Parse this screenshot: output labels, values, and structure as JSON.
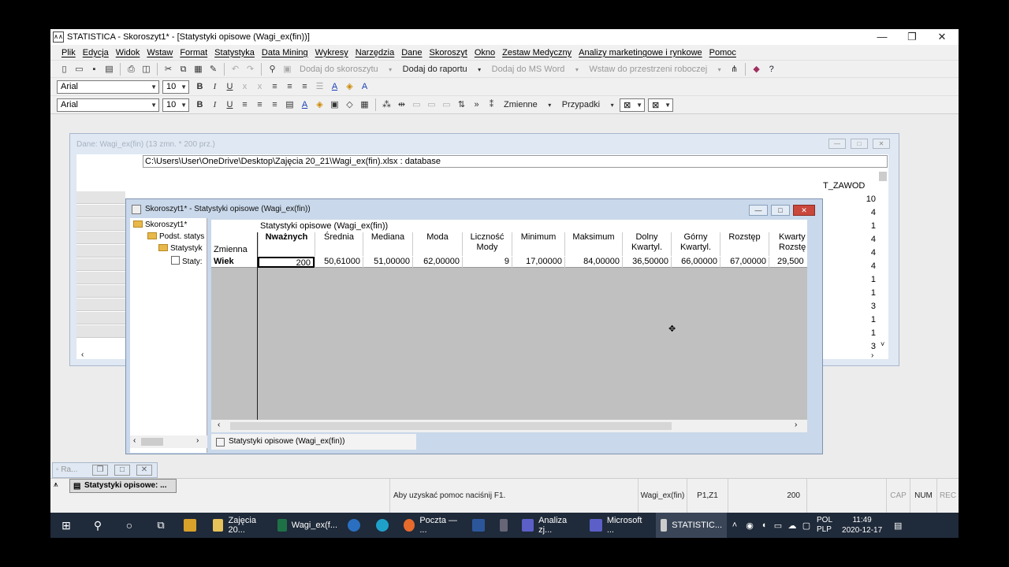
{
  "window": {
    "title": "STATISTICA - Skoroszyt1* - [Statystyki opisowe (Wagi_ex(fin))]",
    "controls": [
      "—",
      "❐",
      "✕"
    ]
  },
  "menu": [
    "Plik",
    "Edycja",
    "Widok",
    "Wstaw",
    "Format",
    "Statystyka",
    "Data Mining",
    "Wykresy",
    "Narzędzia",
    "Dane",
    "Skoroszyt",
    "Okno",
    "Zestaw Medyczny",
    "Analizy marketingowe i rynkowe",
    "Pomoc"
  ],
  "toolbar1": {
    "add_to_workbook": "Dodaj do skoroszytu",
    "add_to_report": "Dodaj do raportu",
    "add_to_msword": "Dodaj do MS Word",
    "add_to_workspace": "Wstaw do przestrzeni roboczej"
  },
  "toolbar2": {
    "font": "Arial",
    "size": "10"
  },
  "toolbar3": {
    "font": "Arial",
    "size": "10",
    "variables": "Zmienne",
    "cases": "Przypadki"
  },
  "data_window": {
    "title": "Dane: Wagi_ex(fin) (13 zmn. * 200 prz.)",
    "path": "C:\\Users\\User\\OneDrive\\Desktop\\Zajęcia 20_21\\Wagi_ex(fin).xlsx : database",
    "col_header": "T_ZAWOD",
    "values": [
      "10",
      "4",
      "1",
      "4",
      "4",
      "4",
      "1",
      "1",
      "3",
      "1",
      "1",
      "3"
    ]
  },
  "workbook": {
    "title": "Skoroszyt1* - Statystyki opisowe (Wagi_ex(fin))",
    "tree": [
      "Skoroszyt1*",
      "Podst. statys",
      "Statystyk",
      "Staty:"
    ],
    "sheet_title": "Statystyki opisowe (Wagi_ex(fin))",
    "row_label_header": "Zmienna",
    "columns": [
      "Nważnych",
      "Średnia",
      "Mediana",
      "Moda",
      "Liczność\nMody",
      "Minimum",
      "Maksimum",
      "Dolny\nKwartyl.",
      "Górny\nKwartyl.",
      "Rozstęp",
      "Kwarty\nRozstę"
    ],
    "rows": [
      {
        "label": "Wiek",
        "values": [
          "200",
          "50,61000",
          "51,00000",
          "62,00000",
          "9",
          "17,00000",
          "84,00000",
          "36,50000",
          "66,00000",
          "67,00000",
          "29,500"
        ]
      }
    ],
    "tab": "Statystyki opisowe (Wagi_ex(fin))"
  },
  "minimized": {
    "label": "Ra..."
  },
  "statusbar": {
    "task": "Statystyki opisowe: ...",
    "help": "Aby uzyskać pomoc naciśnij F1.",
    "dataset": "Wagi_ex(fin)",
    "pos": "P1,Z1",
    "value": "200",
    "cap": "CAP",
    "num": "NUM",
    "rec": "REC"
  },
  "taskbar": {
    "apps": [
      "Zajęcia 20...",
      "Wagi_ex(f...",
      "Poczta — ...",
      "Analiza zj...",
      "Microsoft ...",
      "STATISTIC..."
    ],
    "lang1": "POL",
    "lang2": "PLP",
    "time": "11:49",
    "date": "2020-12-17"
  }
}
